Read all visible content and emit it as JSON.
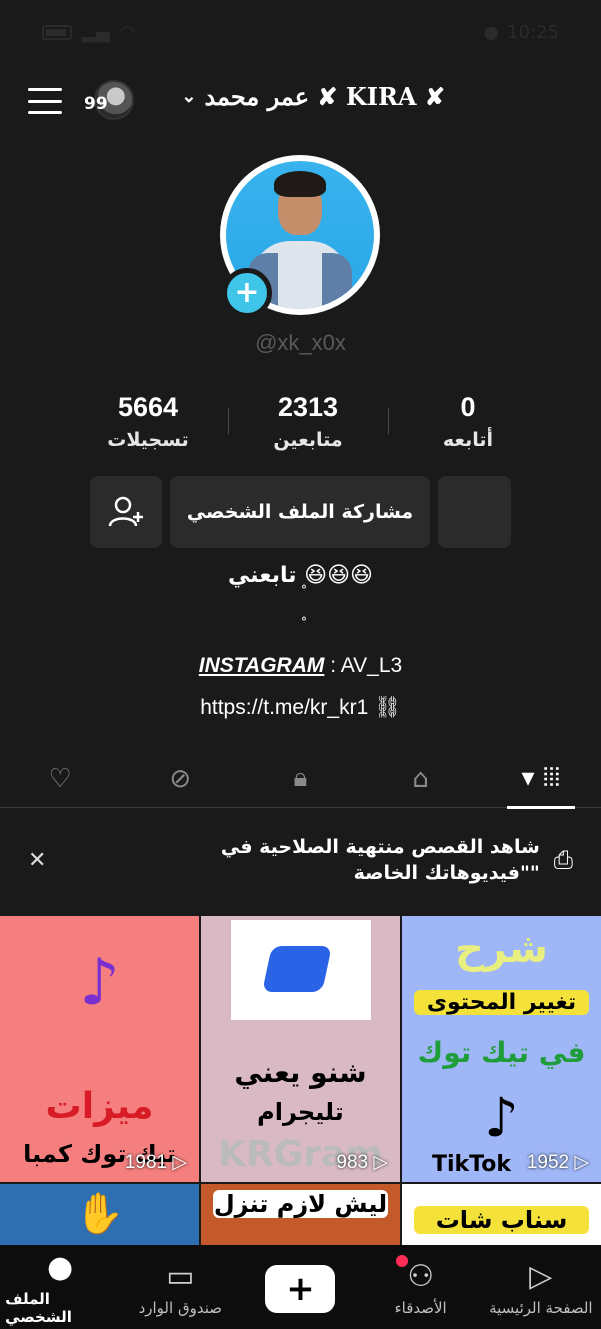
{
  "status": {
    "time": "10:25"
  },
  "header": {
    "story_count": "99",
    "username": "عمر محمد ✘ KIRA ✘"
  },
  "profile": {
    "handle": "@xk_x0x",
    "stats": [
      {
        "value": "0",
        "label": "أتابعه"
      },
      {
        "value": "2313",
        "label": "متابعين"
      },
      {
        "value": "5664",
        "label": "تسجيلات"
      }
    ],
    "share_button": "مشاركة الملف الشخصي",
    "bio_line1": "تابعني 😆😆😆",
    "bio_line2": "ْ",
    "bio_line3": "ْ",
    "bio_instagram_label": "INSTAGRAM",
    "bio_instagram_value": ": AV_L3",
    "link": "https://t.me/kr_kr1"
  },
  "notice": {
    "text": "شاهد القصص منتهية الصلاحية في \"فيديوهاتك الخاصة\""
  },
  "videos": [
    {
      "views": "1952",
      "title": "شرح",
      "sub": "تغيير المحتوى",
      "sub2": "في تيك توك",
      "brand": "TikTok"
    },
    {
      "views": "983",
      "title": "شنو يعني",
      "sub": "تليجرام",
      "brand": "KRGram"
    },
    {
      "views": "1981",
      "title": "ميزات",
      "sub": "تيك توك كمبا"
    },
    {
      "title": "سناب شات"
    },
    {
      "title": "ليش لازم تنزل"
    },
    {
      "title": ""
    }
  ],
  "nav": [
    {
      "label": "الملف الشخصي"
    },
    {
      "label": "صندوق الوارد"
    },
    {
      "label": "+"
    },
    {
      "label": "الأصدقاء"
    },
    {
      "label": "الصفحة الرئيسية"
    }
  ]
}
